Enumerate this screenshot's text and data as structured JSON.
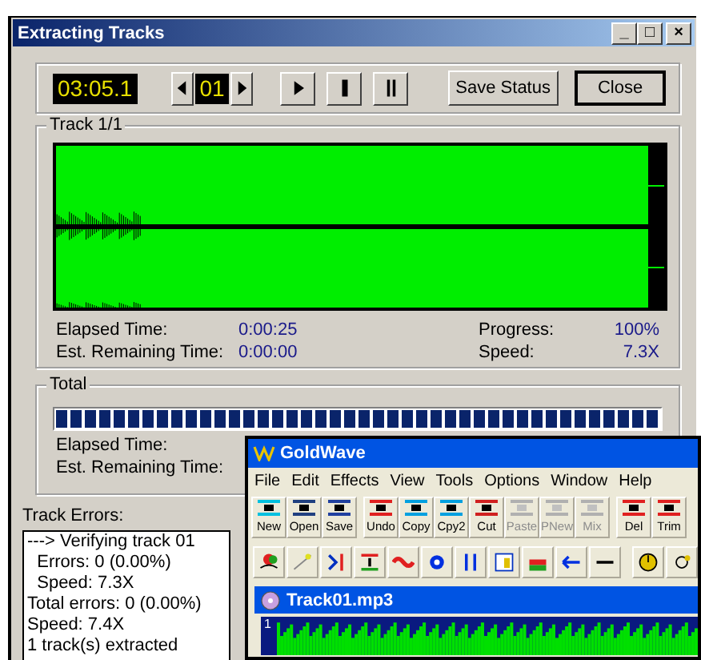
{
  "window": {
    "title": "Extracting Tracks",
    "controls": [
      "_",
      "□",
      "×"
    ]
  },
  "transport": {
    "time": "03:05.1",
    "track": "01",
    "buttons": [
      {
        "kind": "prev"
      },
      {
        "kind": "next"
      },
      {
        "kind": "play"
      },
      {
        "kind": "stop"
      },
      {
        "kind": "pause"
      }
    ],
    "save_status": "Save Status",
    "close": "Close"
  },
  "track_group": {
    "title": "Track 1/1",
    "stats": [
      {
        "label": "Elapsed Time:",
        "value": "0:00:25",
        "label2": "Progress:",
        "value2": "100%"
      },
      {
        "label": "Est. Remaining Time:",
        "value": "0:00:00",
        "label2": "Speed:",
        "value2": "7.3X"
      }
    ]
  },
  "total_group": {
    "title": "Total",
    "level": 1.0,
    "labels": [
      "Elapsed Time:",
      "Est. Remaining Time:"
    ]
  },
  "track_errors": {
    "label": "Track Errors:",
    "lines": [
      "---> Verifying track 01",
      "  Errors: 0 (0.00%)",
      "  Speed: 7.3X",
      "Total errors: 0 (0.00%)",
      "Speed: 7.4X",
      "1 track(s) extracted"
    ]
  },
  "goldwave": {
    "title": "GoldWave",
    "menu": [
      "File",
      "Edit",
      "Effects",
      "View",
      "Tools",
      "Options",
      "Window",
      "Help"
    ],
    "toolbar": [
      {
        "label": "New",
        "disabled": false
      },
      {
        "label": "Open",
        "disabled": false
      },
      {
        "label": "Save",
        "disabled": false
      },
      {
        "label": "Undo",
        "disabled": false
      },
      {
        "label": "Copy",
        "disabled": false
      },
      {
        "label": "Cpy2",
        "disabled": false
      },
      {
        "label": "Cut",
        "disabled": false
      },
      {
        "label": "Paste",
        "disabled": true
      },
      {
        "label": "PNew",
        "disabled": true
      },
      {
        "label": "Mix",
        "disabled": true
      },
      {
        "label": "Del",
        "disabled": false
      },
      {
        "label": "Trim",
        "disabled": false
      }
    ],
    "track_window": {
      "title": "Track01.mp3",
      "channel_label": "1"
    }
  }
}
